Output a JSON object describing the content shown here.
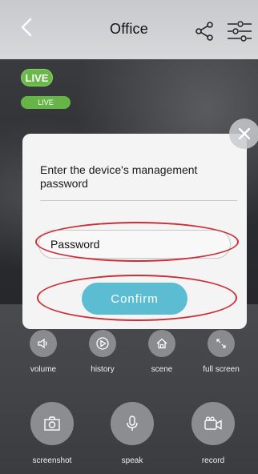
{
  "header": {
    "title": "Office",
    "back_icon": "chevron-left-icon",
    "share_icon": "share-icon",
    "settings_icon": "sliders-icon"
  },
  "video": {
    "live_badge": "LIVE",
    "live_small_badge": "LIVE"
  },
  "dialog": {
    "title": "Enter the device's management password",
    "password_placeholder": "Password",
    "password_value": "",
    "confirm_label": "Confirm",
    "close_icon": "close-icon",
    "annotation_color": "#cc2e36"
  },
  "controls": {
    "row1": [
      {
        "label": "volume",
        "icon": "speaker-icon"
      },
      {
        "label": "history",
        "icon": "play-icon"
      },
      {
        "label": "scene",
        "icon": "home-icon"
      },
      {
        "label": "full screen",
        "icon": "expand-icon"
      }
    ],
    "row2": [
      {
        "label": "screenshot",
        "icon": "camera-icon"
      },
      {
        "label": "speak",
        "icon": "microphone-icon"
      },
      {
        "label": "record",
        "icon": "video-camera-icon"
      }
    ]
  },
  "colors": {
    "live_green": "#6ab84a",
    "confirm_blue": "#5bbcd2"
  }
}
